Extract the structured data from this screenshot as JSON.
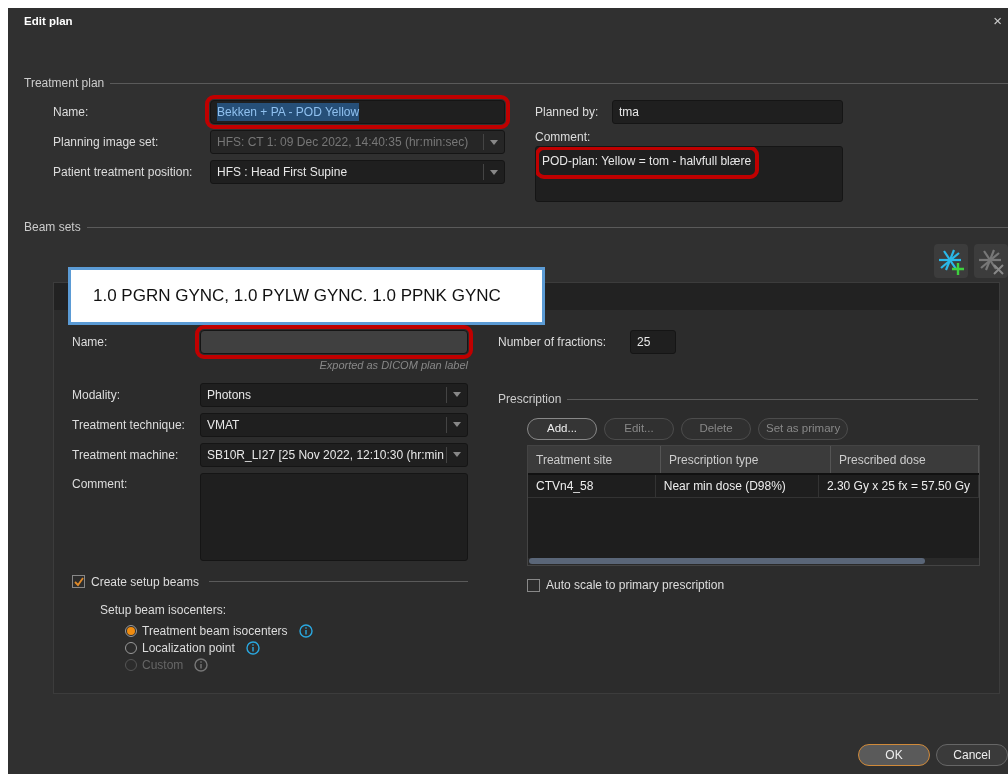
{
  "window": {
    "title": "Edit plan",
    "close": "×"
  },
  "treatment_plan": {
    "heading": "Treatment plan",
    "fields": [
      {
        "label": "Name:",
        "value": "Bekken + PA - POD Yellow",
        "kind": "text",
        "disabled": false,
        "text_selected": true,
        "highlighted": true
      },
      {
        "label": "Planning image set:",
        "value": "HFS: CT 1: 09 Dec 2022, 14:40:35 (hr:min:sec)",
        "kind": "dropdown",
        "disabled": true,
        "text_selected": false,
        "highlighted": false
      },
      {
        "label": "Patient treatment position:",
        "value": "HFS : Head First Supine",
        "kind": "dropdown",
        "disabled": false,
        "text_selected": false,
        "highlighted": false
      }
    ],
    "planned_by": {
      "label": "Planned by:",
      "value": "tma"
    },
    "comment": {
      "label": "Comment:",
      "value": "POD-plan: Yellow = tom - halvfull blære",
      "highlighted": true
    }
  },
  "beam_sets": {
    "heading": "Beam sets",
    "callout": "1.0 PGRN GYNC, 1.0 PYLW GYNC. 1.0 PPNK GYNC",
    "toolbar": [
      {
        "kind": "add",
        "disabled": false
      },
      {
        "kind": "delete",
        "disabled": true
      }
    ],
    "name": {
      "label": "Name:",
      "hint": "Exported as DICOM plan label",
      "highlighted": true
    },
    "fields": [
      {
        "label": "Modality:",
        "value": "Photons"
      },
      {
        "label": "Treatment technique:",
        "value": "VMAT"
      },
      {
        "label": "Treatment machine:",
        "value": "SB10R_LI27 [25 Nov 2022, 12:10:30 (hr:min"
      }
    ],
    "comment": {
      "label": "Comment:"
    },
    "create_setup_beams": {
      "label": "Create setup beams",
      "checked": true
    },
    "isocenters": {
      "label": "Setup beam isocenters:",
      "options": [
        {
          "label": "Treatment beam isocenters",
          "selected": true,
          "disabled": false
        },
        {
          "label": "Localization point",
          "selected": false,
          "disabled": false
        },
        {
          "label": "Custom",
          "selected": false,
          "disabled": true
        }
      ]
    },
    "fractions": {
      "label": "Number of fractions:",
      "value": "25"
    },
    "prescription": {
      "heading": "Prescription",
      "buttons": [
        {
          "label": "Add...",
          "disabled": false
        },
        {
          "label": "Edit...",
          "disabled": true
        },
        {
          "label": "Delete",
          "disabled": true
        },
        {
          "label": "Set as primary",
          "disabled": true
        }
      ],
      "table": {
        "columns": [
          "Treatment site",
          "Prescription type",
          "Prescribed dose"
        ],
        "rows": [
          {
            "cells": [
              "CTVn4_58",
              "Near min dose (D98%)",
              "2.30 Gy x 25 fx = 57.50 Gy"
            ]
          }
        ]
      },
      "auto_scale": {
        "label": "Auto scale to primary prescription",
        "checked": false
      }
    }
  },
  "buttons": [
    {
      "label": "OK",
      "default": true
    },
    {
      "label": "Cancel",
      "default": false
    }
  ]
}
